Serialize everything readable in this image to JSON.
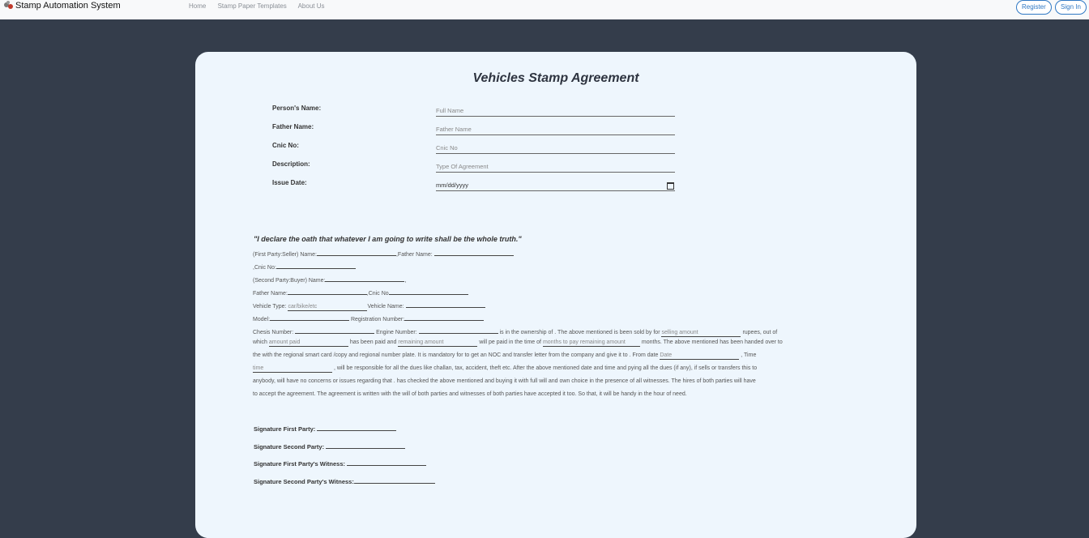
{
  "navbar": {
    "brand": "Stamp Automation System",
    "links": [
      "Home",
      "Stamp Paper Templates",
      "About Us"
    ],
    "register": "Register",
    "signin": "Sign In"
  },
  "form": {
    "title": "Vehicles Stamp Agreement",
    "fields": [
      {
        "label": "Person's Name:",
        "placeholder": "Full Name"
      },
      {
        "label": "Father Name:",
        "placeholder": "Father Name"
      },
      {
        "label": "Cnic No:",
        "placeholder": "Cnic No"
      },
      {
        "label": "Description:",
        "placeholder": "Type Of Agreement"
      },
      {
        "label": "Issue Date:",
        "placeholder": "mm/dd/yyyy"
      }
    ]
  },
  "agreement": {
    "oath": "\"I declare the oath that whatever I am going to write shall be the whole truth.\"",
    "l1a": "(First Party:Seller) Name:",
    "l1b": ",Father Name:",
    "l2": ",Cnic No:",
    "l3": "(Second Party:Buyer) Name:",
    "l3end": ",",
    "l4a": "Father Name:",
    "l4b": ",Cnic No",
    "l5a": "Vehicle Type:",
    "l5ph": "car/bike/etc",
    "l5b": "Vehicle Name:",
    "l6a": "Model:",
    "l6b": "Registration Number:",
    "l7a": "Chesis Number:",
    "l7b": "Engine Number:",
    "l7c": "is in the ownership of . The above mentioned is been sold by for",
    "l7ph": "selling amount",
    "l7d": "rupees, out of",
    "l8a": "which",
    "l8ph1": "amount paid",
    "l8b": "has been paid and",
    "l8ph2": "remaining amount",
    "l8c": "will pe paid in the time of",
    "l8ph3": "months to pay remaining amount",
    "l8d": "months. The above mentioned has been handed over to",
    "l9a": "the with the regional smart card /copy and regional number plate. It is mandatory for to get an NOC and transfer letter from the company and give it to . From date",
    "l9ph": "Date",
    "l9b": ", Time",
    "l10ph": "time",
    "l10a": ", will be responsible for all the dues like challan, tax, accident, theft etc. After the above mentioned date and time and pying all the dues (if any), if sells or transfers this to",
    "l11": "anybody, will have no concerns or issues regarding that . has checked the above mentioned and buying it with full will and own choice in the presence of all witnesses. The hires of both parties will have",
    "l12": "to accept the agreement. The agreement is written with the will of both parties and witnesses of both parties have accepted it too. So that, it will be handy in the hour of need."
  },
  "signatures": {
    "first": "Signature First Party:",
    "second": "Signature Second Party:",
    "first_witness": "Signature First Party's Witness:",
    "second_witness": "Signature Second Party's Witness:"
  }
}
